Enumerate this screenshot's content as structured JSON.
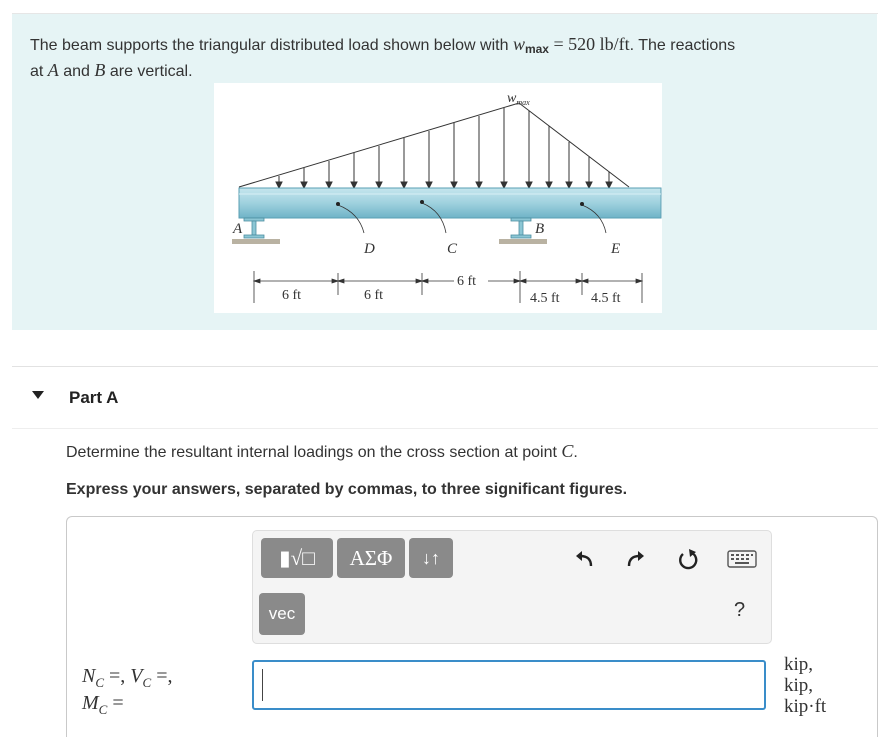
{
  "problem": {
    "text_pre": "The beam supports the triangular distributed load shown below with ",
    "wmax_symbol": "w",
    "wmax_sub": "max",
    "equals": " = 520 lb/ft",
    "text_post": ". The reactions",
    "line2_pre": "at ",
    "point_a": "A",
    "line2_mid": " and ",
    "point_b": "B",
    "line2_post": " are vertical."
  },
  "figure": {
    "load_label": "w",
    "load_label_sub": "max",
    "point_labels": [
      "A",
      "B",
      "C",
      "D",
      "E"
    ],
    "dimensions": [
      "6 ft",
      "6 ft",
      "6 ft",
      "4.5 ft",
      "4.5 ft"
    ]
  },
  "part": {
    "title": "Part A"
  },
  "question": {
    "text_pre": "Determine the resultant internal loadings on the cross section at point ",
    "point": "C",
    "text_post": ".",
    "instruction": "Express your answers, separated by commas, to three significant figures."
  },
  "toolbar": {
    "templates_label": "▮√□",
    "greek_label": "ΑΣΦ",
    "arrows_label": "↓↑",
    "vec_label": "vec",
    "help_label": "?"
  },
  "answer": {
    "line1": "Nᴄ =, Vᴄ =,",
    "line2": "Mᴄ =",
    "value": "",
    "units": [
      "kip,",
      "kip,",
      "kip·ft"
    ]
  },
  "colors": {
    "problem_bg": "#e6f4f5",
    "input_border": "#3a8dc9",
    "button_gray": "#8a8a8a",
    "beam": "#9fd1de"
  }
}
